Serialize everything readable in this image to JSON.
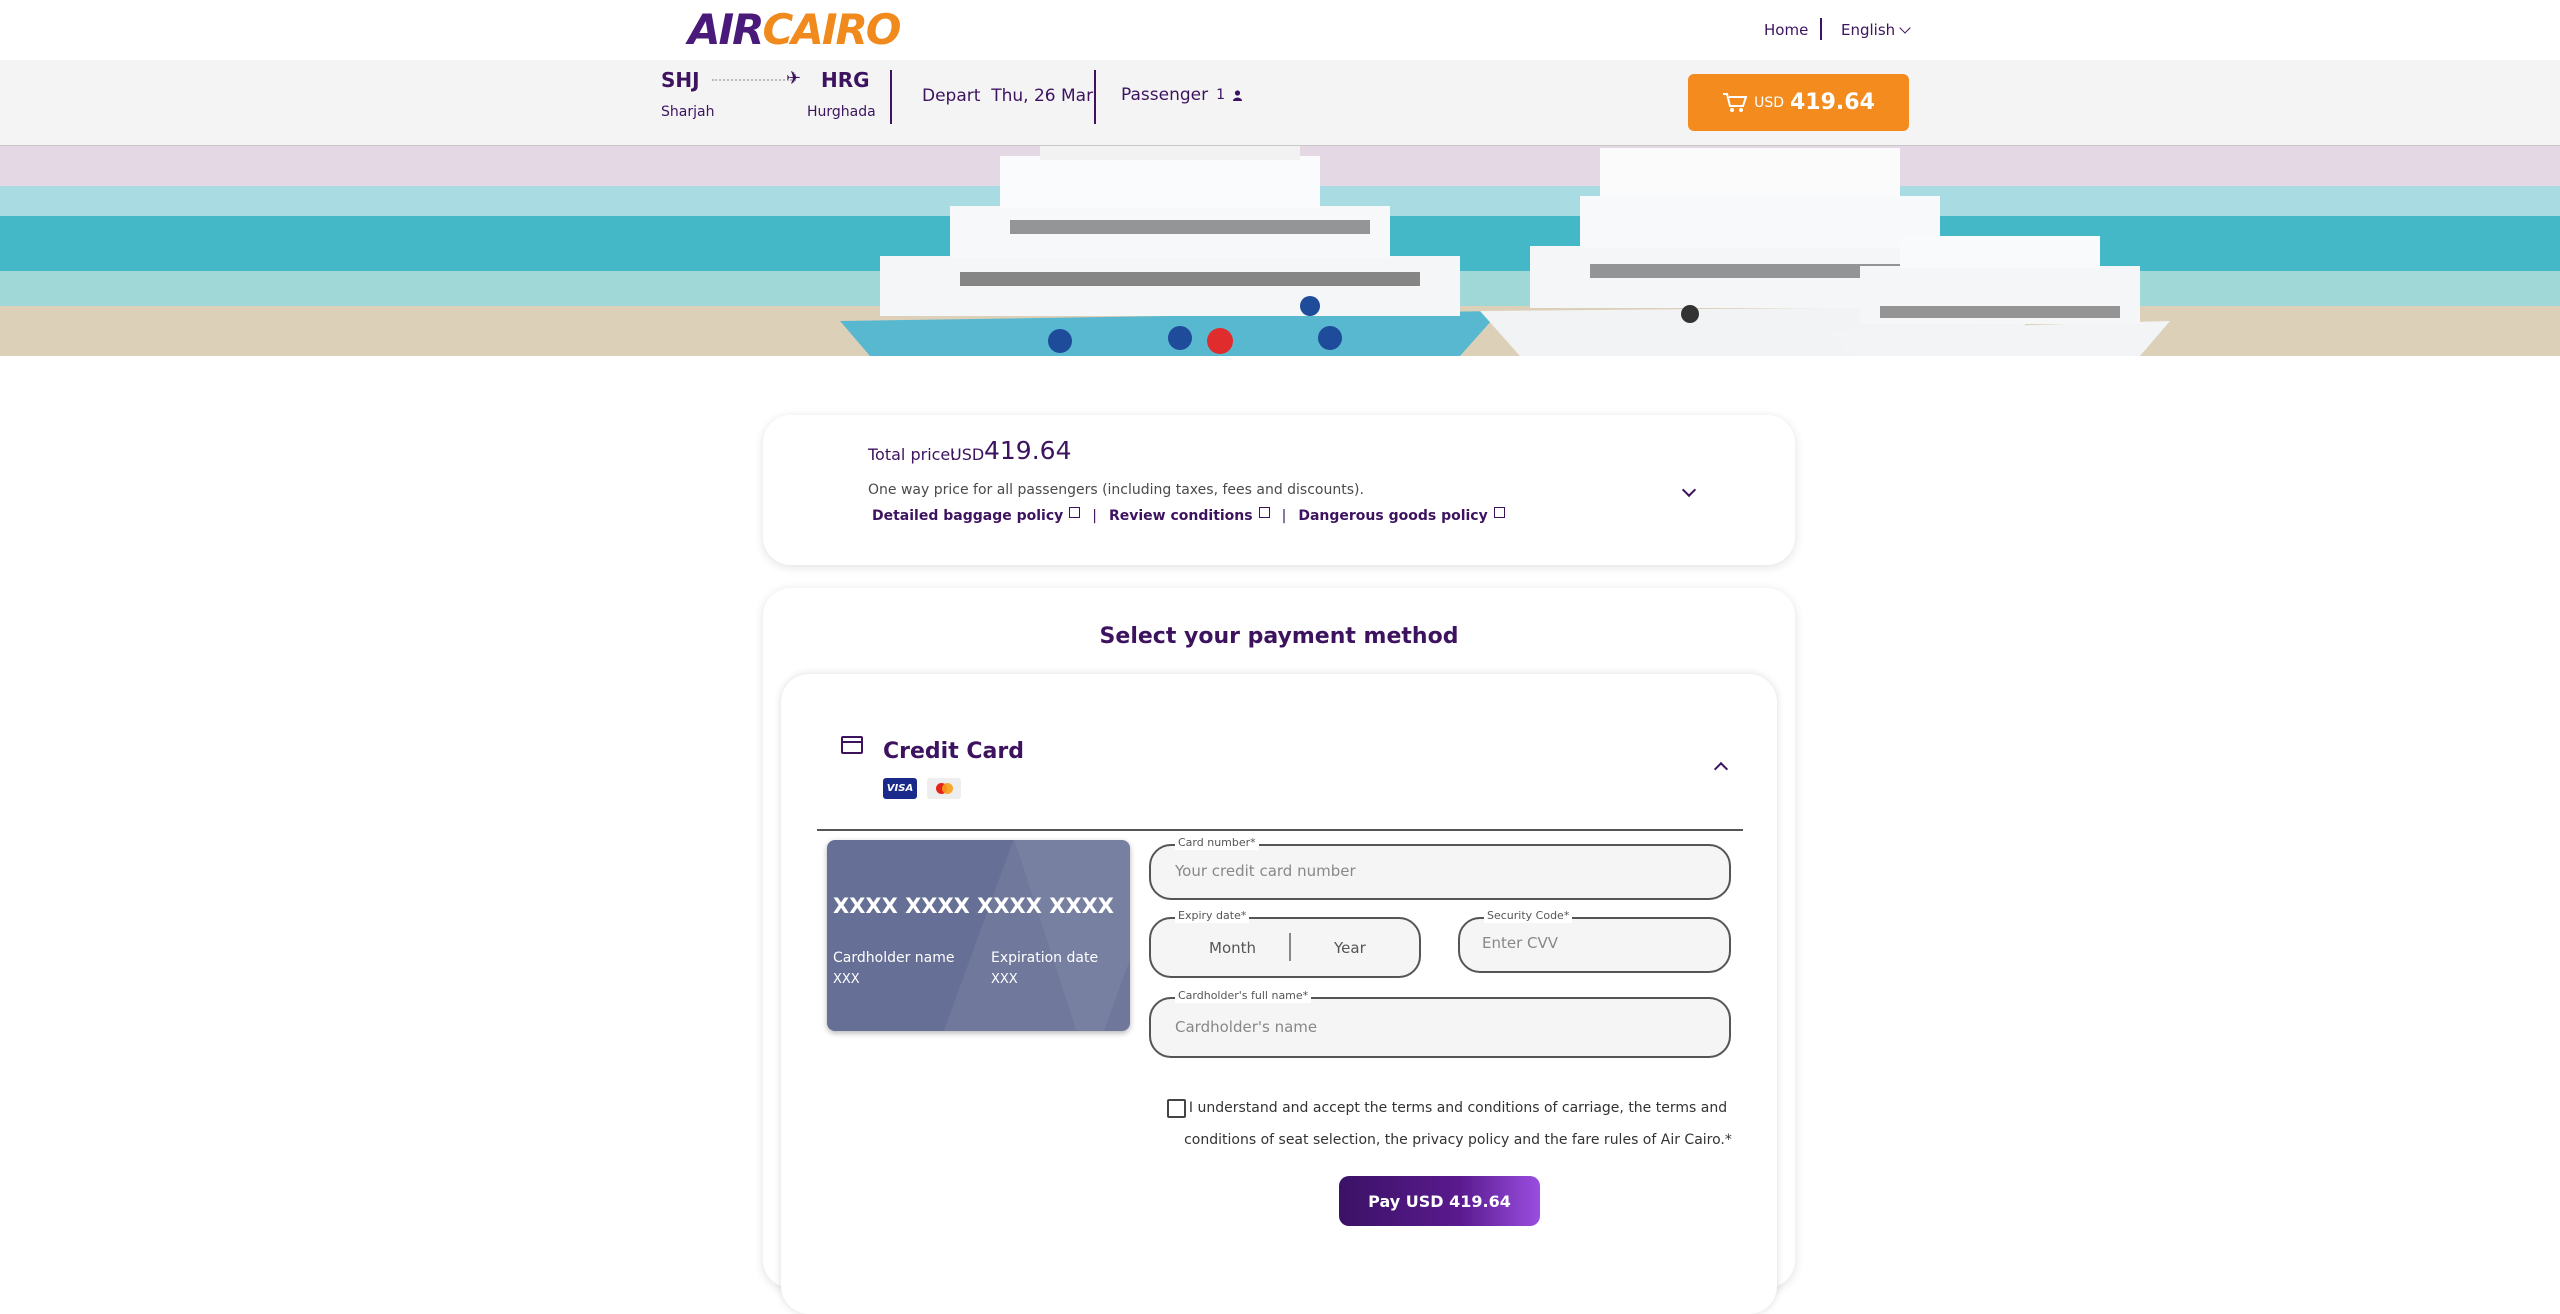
{
  "header": {
    "logo": {
      "air": "AIR",
      "cairo": "CAIRO"
    },
    "nav": {
      "home": "Home",
      "language": "English"
    }
  },
  "flight": {
    "origin_code": "SHJ",
    "origin_city": "Sharjah",
    "dest_code": "HRG",
    "dest_city": "Hurghada",
    "depart_label": "Depart",
    "depart_date": "Thu, 26 Mar",
    "passenger_label": "Passenger",
    "passenger_count": "1",
    "cart_currency": "USD",
    "cart_amount": "419.64"
  },
  "price": {
    "label": "Total price:",
    "currency": "USD",
    "amount": "419.64",
    "note": "One way price for all passengers (including taxes, fees and discounts).",
    "links": [
      "Detailed baggage policy",
      "Review conditions",
      "Dangerous goods policy"
    ],
    "link_separator": "|"
  },
  "payment": {
    "title": "Select your payment method",
    "method": "Credit Card",
    "visa_badge": "VISA",
    "card_preview": {
      "number": "XXXX XXXX XXXX XXXX",
      "holder_label": "Cardholder name",
      "holder_value": "XXX",
      "expiry_label": "Expiration date",
      "expiry_value": "XXX"
    },
    "fields": {
      "card_number_label": "Card number*",
      "card_number_placeholder": "Your credit card number",
      "expiry_label": "Expiry date*",
      "month": "Month",
      "year": "Year",
      "cvv_label": "Security Code*",
      "cvv_placeholder": "Enter CVV",
      "name_label": "Cardholder's full name*",
      "name_placeholder": "Cardholder's name"
    },
    "terms": "I understand and accept the terms and conditions of carriage, the terms and conditions of seat selection, the privacy policy and the fare rules of Air Cairo.*",
    "pay_button": "Pay USD 419.64"
  },
  "colors": {
    "brand_purple": "#3d1360",
    "accent_orange": "#f38b1f"
  }
}
